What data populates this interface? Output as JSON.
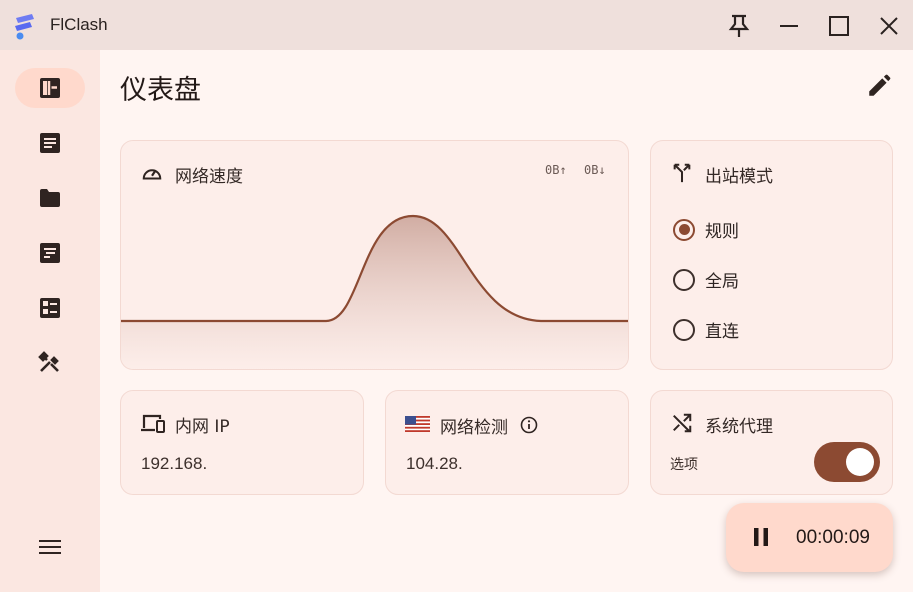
{
  "app": {
    "title": "FlClash"
  },
  "window_controls": [
    "pin-icon",
    "minimize-icon",
    "maximize-icon",
    "close-icon"
  ],
  "sidebar": {
    "items": [
      {
        "icon": "dashboard-icon",
        "active": true
      },
      {
        "icon": "article-icon",
        "active": false
      },
      {
        "icon": "folder-icon",
        "active": false
      },
      {
        "icon": "notes-icon",
        "active": false
      },
      {
        "icon": "checklist-icon",
        "active": false
      },
      {
        "icon": "tools-icon",
        "active": false
      }
    ],
    "menu_icon": "menu-icon"
  },
  "page": {
    "title": "仪表盘",
    "edit_icon": "edit-icon"
  },
  "network_speed": {
    "title": "网络速度",
    "upload": "0B↑",
    "download": "0B↓"
  },
  "outbound_mode": {
    "title": "出站模式",
    "options": [
      {
        "label": "规则",
        "checked": true
      },
      {
        "label": "全局",
        "checked": false
      },
      {
        "label": "直连",
        "checked": false
      }
    ]
  },
  "intranet_ip": {
    "title": "内网 IP",
    "value": "192.168."
  },
  "network_check": {
    "title": "网络检测",
    "value": "104.28."
  },
  "system_proxy": {
    "title": "系统代理",
    "option_label": "选项",
    "enabled": true
  },
  "timer": {
    "value": "00:00:09"
  },
  "colors": {
    "accent": "#8c4a32",
    "background": "#fff5f2",
    "sidebar": "#fbe7e1",
    "active_nav": "#ffd9cc"
  }
}
